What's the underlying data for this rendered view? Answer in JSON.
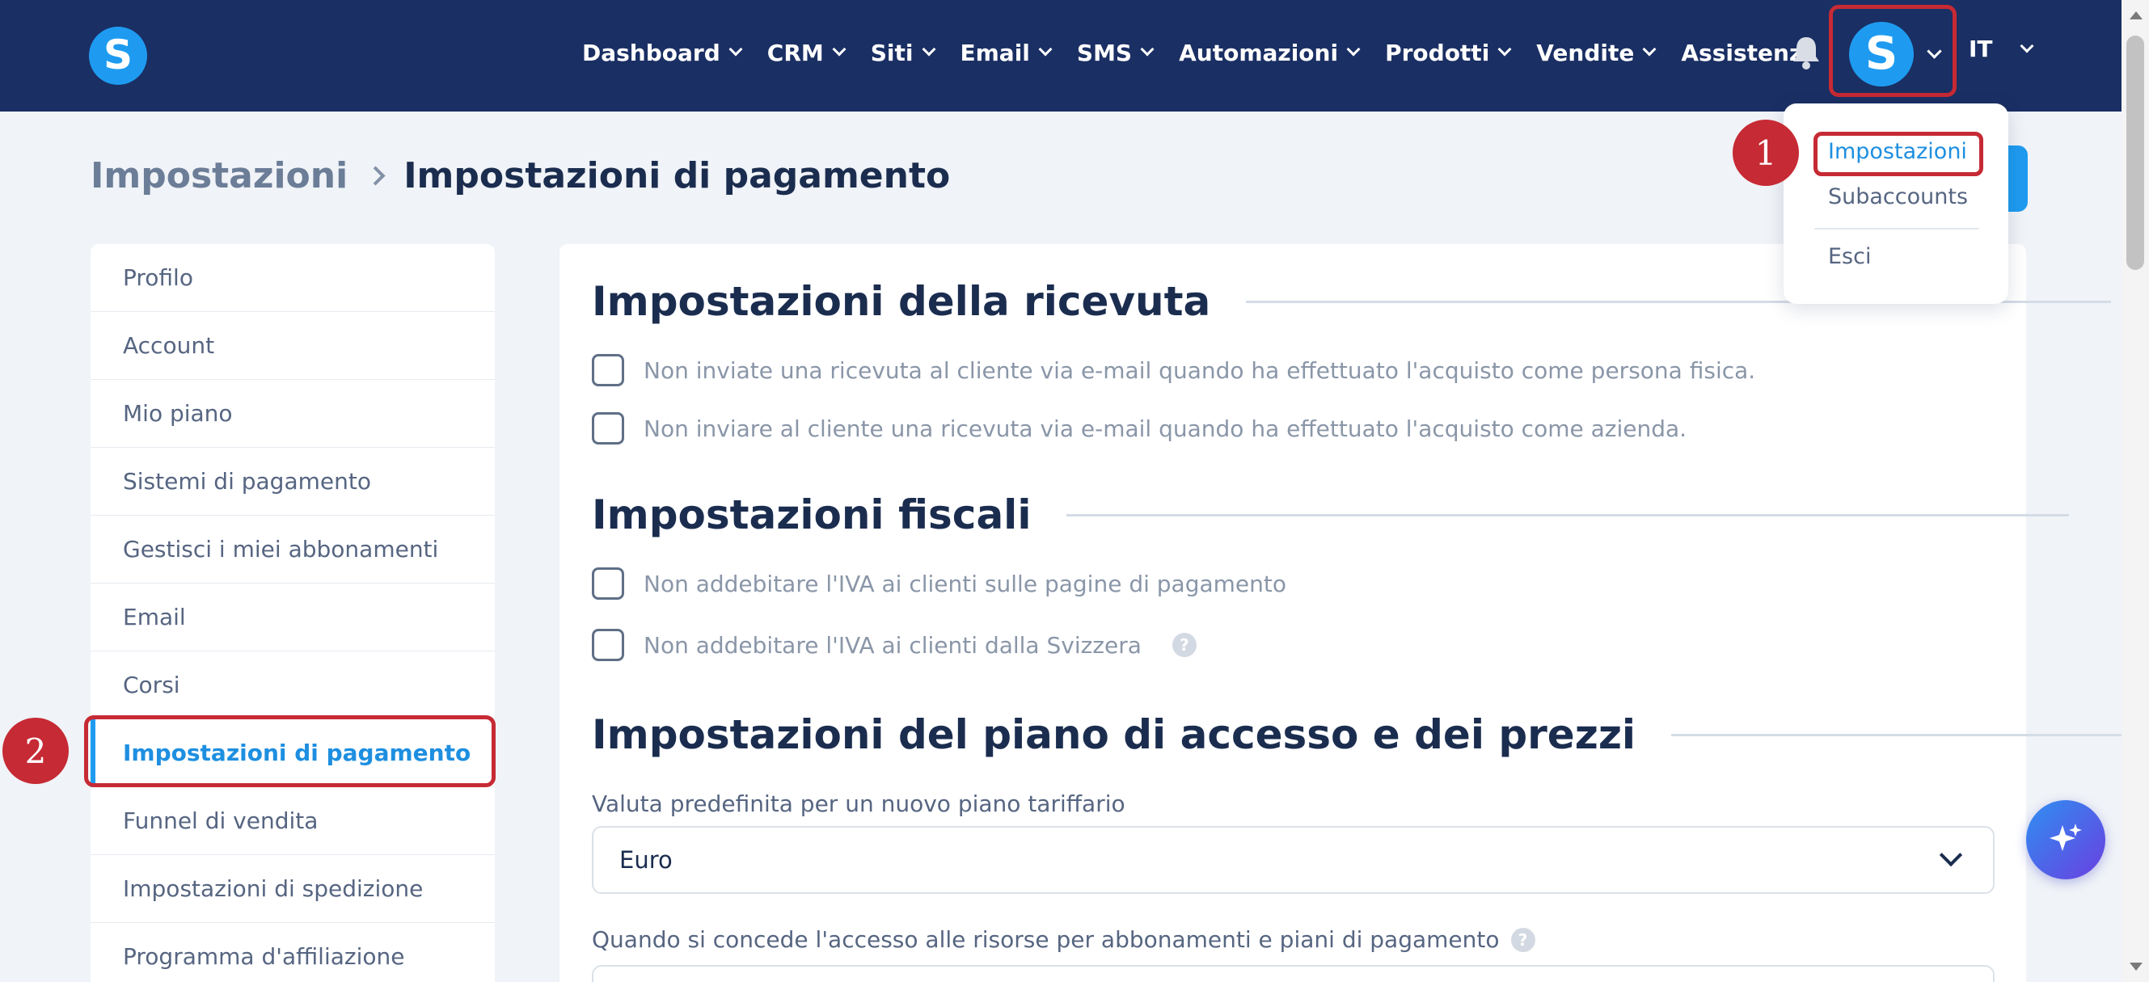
{
  "brand": {
    "logo_letter": "S"
  },
  "nav": {
    "items": [
      {
        "label": "Dashboard",
        "dropdown": true
      },
      {
        "label": "CRM",
        "dropdown": true
      },
      {
        "label": "Siti",
        "dropdown": true
      },
      {
        "label": "Email",
        "dropdown": true
      },
      {
        "label": "SMS",
        "dropdown": true
      },
      {
        "label": "Automazioni",
        "dropdown": true
      },
      {
        "label": "Prodotti",
        "dropdown": true
      },
      {
        "label": "Vendite",
        "dropdown": true
      },
      {
        "label": "Assistenza",
        "dropdown": false
      }
    ],
    "avatar_letter": "S",
    "language": "IT"
  },
  "breadcrumb": {
    "root": "Impostazioni",
    "current": "Impostazioni di pagamento"
  },
  "sidebar": {
    "items": [
      {
        "label": "Profilo"
      },
      {
        "label": "Account"
      },
      {
        "label": "Mio piano"
      },
      {
        "label": "Sistemi di pagamento"
      },
      {
        "label": "Gestisci i miei abbonamenti"
      },
      {
        "label": "Email"
      },
      {
        "label": "Corsi"
      },
      {
        "label": "Impostazioni di pagamento",
        "active": true
      },
      {
        "label": "Funnel di vendita"
      },
      {
        "label": "Impostazioni di spedizione"
      },
      {
        "label": "Programma d'affiliazione"
      }
    ]
  },
  "main": {
    "receipt": {
      "title": "Impostazioni della ricevuta",
      "options": [
        "Non inviate una ricevuta al cliente via e-mail quando ha effettuato l'acquisto come persona fisica.",
        "Non inviare al cliente una ricevuta via e-mail quando ha effettuato l'acquisto come azienda."
      ]
    },
    "tax": {
      "title": "Impostazioni fiscali",
      "options": [
        "Non addebitare l'IVA ai clienti sulle pagine di pagamento",
        "Non addebitare l'IVA ai clienti dalla Svizzera"
      ],
      "help": "?"
    },
    "pricing": {
      "title": "Impostazioni del piano di accesso e dei prezzi",
      "currency_label": "Valuta predefinita per un nuovo piano tariffario",
      "currency_value": "Euro",
      "access_label": "Quando si concede l'accesso alle risorse per abbonamenti e piani di pagamento",
      "help": "?"
    }
  },
  "user_menu": {
    "items": [
      "Impostazioni",
      "Subaccounts",
      "Esci"
    ]
  },
  "annotations": {
    "badge_1": "1",
    "badge_2": "2",
    "color": "#c62a34"
  },
  "colors": {
    "nav_bg": "#1a2f63",
    "accent": "#1e9bf0",
    "page_bg": "#f0f3f7"
  },
  "icons": [
    "bell-icon",
    "chevron-down-icon",
    "help-icon",
    "sparkle-icon"
  ]
}
